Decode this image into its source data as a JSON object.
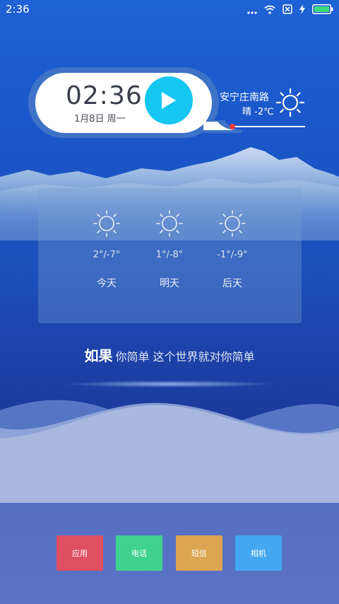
{
  "status_bar": {
    "time": "2:36"
  },
  "clock": {
    "time": "02:36",
    "date": "1月8日 周一"
  },
  "weather": {
    "location": "安宁庄南路",
    "condition": "晴 -2℃"
  },
  "forecast": [
    {
      "temp": "2°/-7°",
      "day": "今天",
      "icon": "sun-icon"
    },
    {
      "temp": "1°/-8°",
      "day": "明天",
      "icon": "sun-icon"
    },
    {
      "temp": "-1°/-9°",
      "day": "后天",
      "icon": "sun-icon"
    }
  ],
  "slogan": {
    "strong": "如果",
    "rest": "你简单 这个世界就对你简单"
  },
  "dock": [
    {
      "label": "应用",
      "color": "#df4f62"
    },
    {
      "label": "电话",
      "color": "#3fd28e"
    },
    {
      "label": "短信",
      "color": "#dca552"
    },
    {
      "label": "相机",
      "color": "#43a8ef"
    }
  ],
  "colors": {
    "play": "#16c7f2",
    "timeline_dot": "#ff3a3a"
  }
}
